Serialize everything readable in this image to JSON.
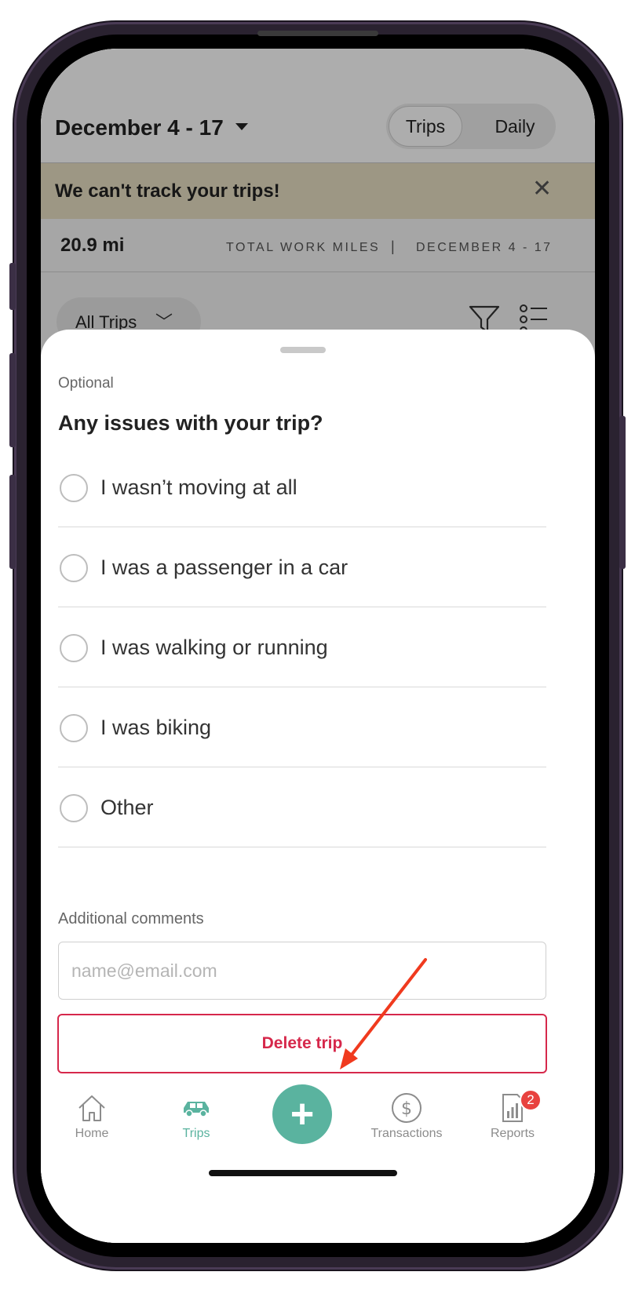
{
  "header": {
    "date_range": "December 4 - 17",
    "segment": {
      "trips_label": "Trips",
      "daily_label": "Daily",
      "selected": "Trips"
    }
  },
  "banner": {
    "message": "We can't track your trips!",
    "close_glyph": "✕"
  },
  "stats": {
    "miles": "20.9 mi",
    "label": "TOTAL WORK MILES",
    "separator": "|",
    "range": "DECEMBER 4 - 17"
  },
  "filter": {
    "label": "All Trips",
    "chevron": "﹀"
  },
  "sheet": {
    "optional_label": "Optional",
    "question": "Any issues with your trip?",
    "options": [
      {
        "label": "I wasn’t moving at all",
        "selected": false
      },
      {
        "label": "I was a passenger in a car",
        "selected": false
      },
      {
        "label": "I was walking or running",
        "selected": false
      },
      {
        "label": "I was biking",
        "selected": false
      },
      {
        "label": "Other",
        "selected": false
      }
    ],
    "comments_label": "Additional comments",
    "comments_placeholder": "name@email.com",
    "comments_value": "",
    "delete_label": "Delete trip"
  },
  "tabbar": {
    "home": "Home",
    "trips": "Trips",
    "fab_glyph": "+",
    "transactions": "Transactions",
    "reports": "Reports",
    "reports_badge": "2",
    "active": "Trips"
  },
  "colors": {
    "accent": "#5ab39f",
    "danger": "#d6284b",
    "banner_bg": "#e8dfc3",
    "badge": "#e8423f",
    "annotation_arrow": "#f03a1e"
  }
}
